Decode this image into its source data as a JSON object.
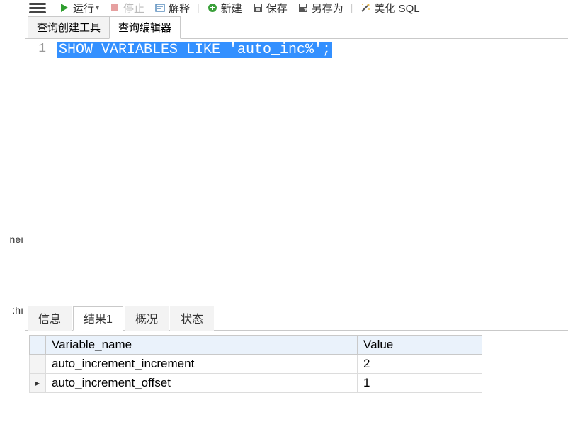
{
  "toolbar": {
    "run_label": "运行",
    "stop_label": "停止",
    "explain_label": "解释",
    "new_label": "新建",
    "save_label": "保存",
    "save_as_label": "另存为",
    "beautify_label": "美化 SQL"
  },
  "editor_tabs": {
    "builder_label": "查询创建工具",
    "editor_label": "查询编辑器"
  },
  "editor": {
    "line_numbers": [
      "1"
    ],
    "sql_text": "SHOW VARIABLES LIKE 'auto_inc%';"
  },
  "result_tabs": {
    "info_label": "信息",
    "result1_label": "结果1",
    "profile_label": "概况",
    "status_label": "状态"
  },
  "result_grid": {
    "columns": [
      "Variable_name",
      "Value"
    ],
    "rows": [
      {
        "Variable_name": "auto_increment_increment",
        "Value": "2"
      },
      {
        "Variable_name": "auto_increment_offset",
        "Value": "1"
      }
    ],
    "current_row_marker": "▸"
  },
  "left_sliver": {
    "frag1": "neı",
    "frag2": ":hı"
  }
}
